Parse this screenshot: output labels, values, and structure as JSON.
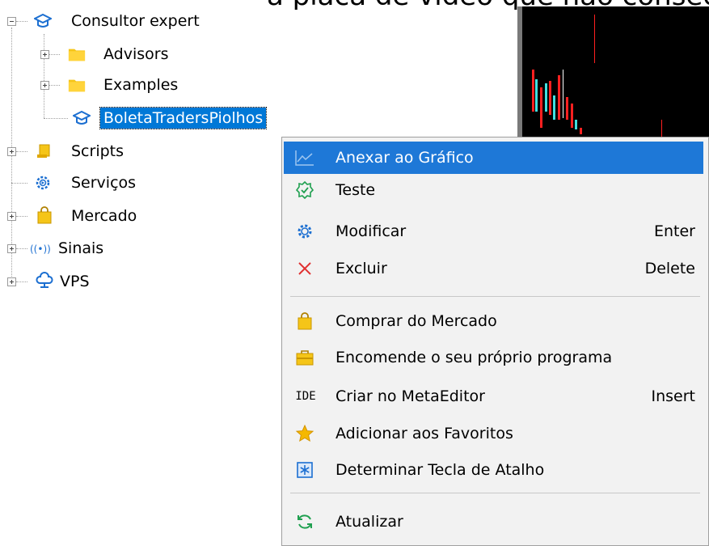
{
  "top_text": "a placa de vídeo que não consegue com o peso",
  "tree": {
    "root": {
      "label": "Consultor expert",
      "icon": "graduation-cap-icon"
    },
    "children": [
      {
        "label": "Advisors",
        "icon": "folder-icon"
      },
      {
        "label": "Examples",
        "icon": "folder-icon"
      },
      {
        "label": "BoletaTradersPiolhos",
        "icon": "graduation-cap-icon",
        "selected": true
      }
    ],
    "siblings": [
      {
        "label": "Scripts",
        "icon": "script-icon"
      },
      {
        "label": "Serviços",
        "icon": "services-icon"
      },
      {
        "label": "Mercado",
        "icon": "market-bag-icon"
      },
      {
        "label": "Sinais",
        "icon": "signals-icon"
      },
      {
        "label": "VPS",
        "icon": "cloud-icon"
      }
    ]
  },
  "menu": {
    "items": [
      {
        "label": "Anexar ao Gráfico",
        "shortcut": "",
        "icon": "chart-line-icon",
        "highlighted": true
      },
      {
        "label": "Teste",
        "shortcut": "",
        "icon": "test-badge-icon"
      },
      {
        "label": "Modificar",
        "shortcut": "Enter",
        "icon": "gear-icon"
      },
      {
        "label": "Excluir",
        "shortcut": "Delete",
        "icon": "delete-x-icon"
      },
      {
        "label": "Comprar do Mercado",
        "shortcut": "",
        "icon": "shopping-bag-icon"
      },
      {
        "label": "Encomende o seu próprio programa",
        "shortcut": "",
        "icon": "briefcase-icon"
      },
      {
        "label": "Criar no MetaEditor",
        "shortcut": "Insert",
        "icon": "ide-icon",
        "icon_text": "IDE"
      },
      {
        "label": "Adicionar aos Favoritos",
        "shortcut": "",
        "icon": "star-icon"
      },
      {
        "label": "Determinar Tecla de Atalho",
        "shortcut": "",
        "icon": "hotkey-icon"
      },
      {
        "label": "Atualizar",
        "shortcut": "",
        "icon": "refresh-icon"
      }
    ]
  },
  "colors": {
    "highlight": "#1e78d7",
    "selected": "#0078d7",
    "candle_red": "#ff2020",
    "candle_cyan": "#40e0e0",
    "candle_white": "#ffffff"
  }
}
